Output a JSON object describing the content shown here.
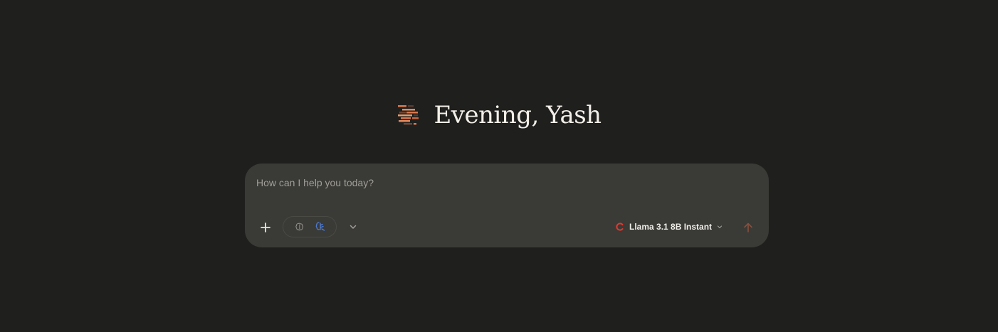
{
  "greeting": {
    "text": "Evening, Yash",
    "logo_icon": "striped-bars-logo-icon"
  },
  "composer": {
    "placeholder": "How can I help you today?",
    "value": "",
    "buttons": {
      "add_icon": "plus-icon",
      "tool_icons": [
        "brain-icon",
        "sparkle-star-icon"
      ],
      "more_icon": "chevron-down-icon",
      "send_icon": "arrow-up-icon"
    },
    "model": {
      "label": "Llama 3.1 8B Instant",
      "icon": "groq-c-logo-icon",
      "dropdown_icon": "chevron-down-icon"
    }
  },
  "colors": {
    "background": "#1f1f1e",
    "composer_bg": "#3a3a36",
    "accent_orange": "#d9774f",
    "model_logo_red": "#e03a2f",
    "tool_active_blue": "#4e7fd9",
    "send_arrow": "#8a4f3c"
  }
}
